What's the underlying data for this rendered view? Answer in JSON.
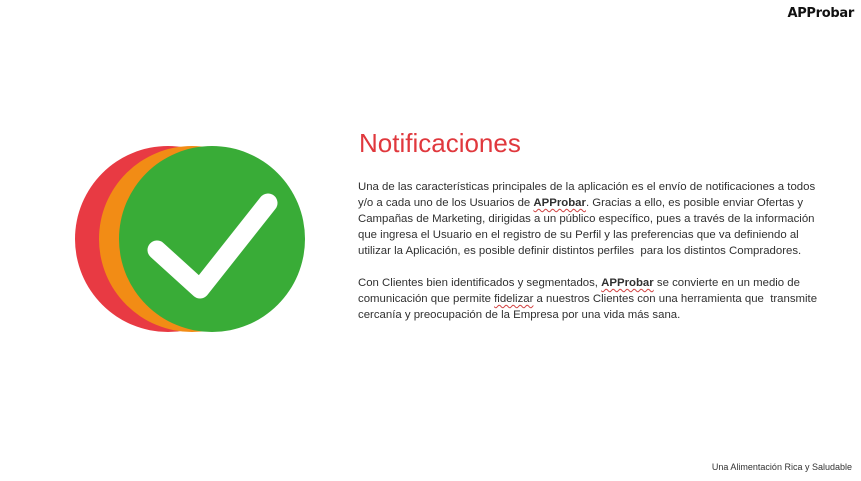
{
  "brand": {
    "logo_text": "APProbar"
  },
  "graphic": {
    "icon": "check-mark-icon",
    "circle_colors": [
      "#e83a43",
      "#f28c15",
      "#39ac37"
    ],
    "check_color": "#ffffff"
  },
  "content": {
    "title": "Notificaciones",
    "title_color": "#e0383d",
    "paragraph1": {
      "part1": "Una de las características principales de la aplicación es el envío de notificaciones a todos y/o a cada uno de los Usuarios de ",
      "brand": "APProbar",
      "part2": ". Gracias a ello, es posible enviar Ofertas y Campañas de Marketing, dirigidas a un público específico, pues a través de la información que ingresa el Usuario en el registro de su Perfil y las preferencias que va definiendo al utilizar la Aplicación, es posible definir distintos perfiles  para los distintos Compradores."
    },
    "paragraph2": {
      "part1": "Con Clientes bien identificados y segmentados, ",
      "brand": "APProbar",
      "part2": " se convierte en un medio de comunicación que permite ",
      "word_fidelizar": "fidelizar",
      "part3": " a nuestros Clientes con una herramienta que  transmite cercanía y preocupación de la Empresa por una vida más sana."
    }
  },
  "footer": {
    "tagline": "Una Alimentación Rica y Saludable"
  }
}
